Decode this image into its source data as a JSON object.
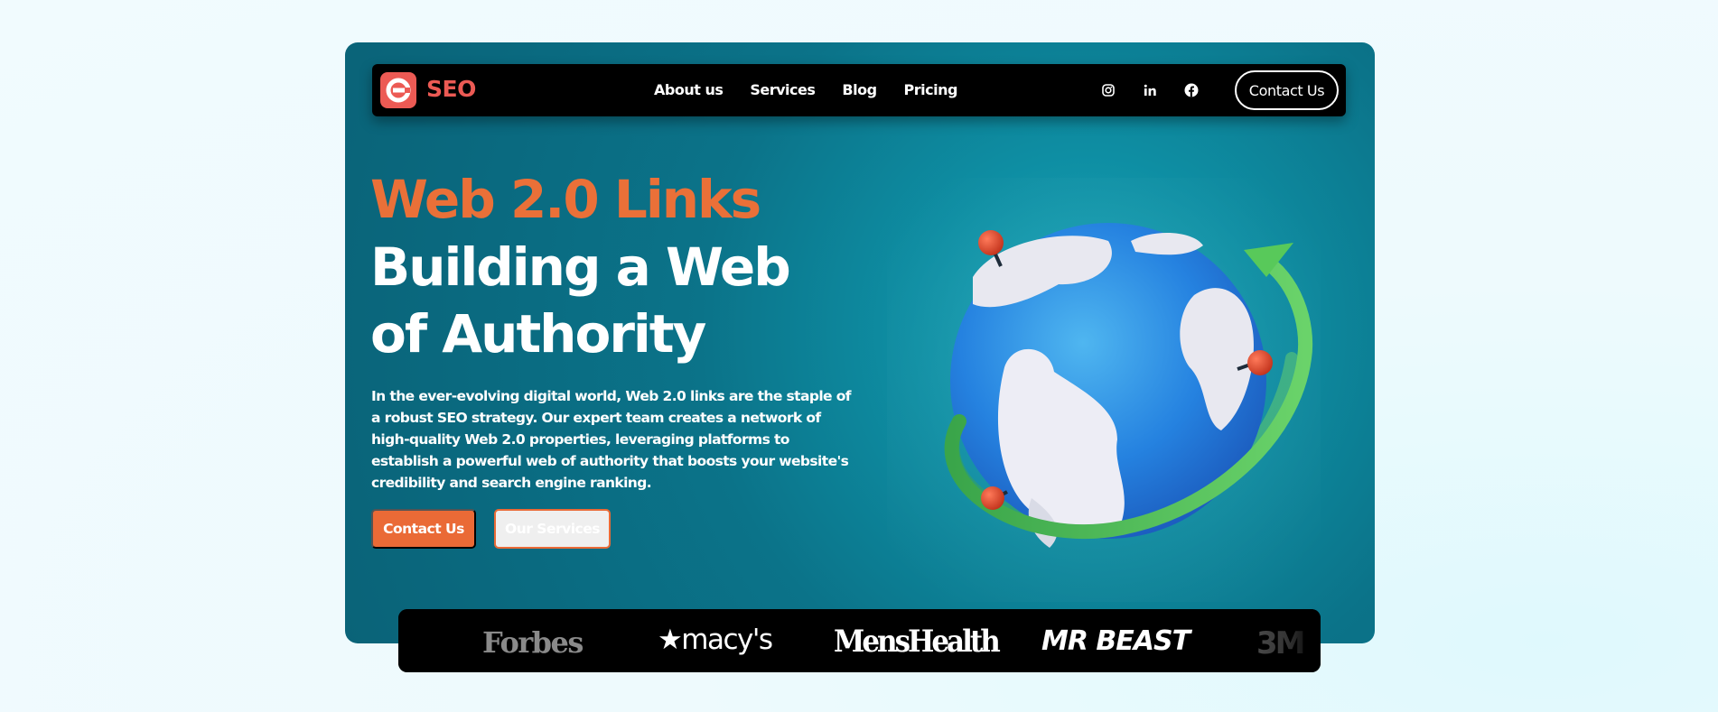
{
  "brand": {
    "logo_text": "SEO",
    "logo_color": "#ec5a54"
  },
  "nav": {
    "links": [
      "About us",
      "Services",
      "Blog",
      "Pricing"
    ],
    "social_icons": [
      "instagram-icon",
      "linkedin-icon",
      "facebook-icon"
    ],
    "contact_label": "Contact Us"
  },
  "hero": {
    "headline_accent": "Web 2.0 Links",
    "headline_main": "Building a Web of Authority",
    "description": "In the ever-evolving digital world, Web 2.0 links are the staple of a robust SEO strategy. Our expert team creates a network of high-quality Web 2.0 properties, leveraging platforms to establish a powerful web of authority that boosts your website's credibility and search engine ranking.",
    "primary_button": "Contact Us",
    "secondary_button": "Our Services"
  },
  "logos": {
    "forbes": "Forbes",
    "macys": "★macy's",
    "menshealth": "MensHealth",
    "mrbeast": "MR BEAST",
    "threem": "3M"
  },
  "colors": {
    "accent": "#ea6a36",
    "hero_bg": "#0a6a80",
    "navbar": "#000000"
  }
}
